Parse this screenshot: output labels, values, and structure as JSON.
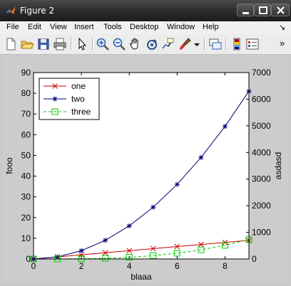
{
  "window": {
    "title": "Figure 2"
  },
  "menu": {
    "items": [
      "File",
      "Edit",
      "View",
      "Insert",
      "Tools",
      "Desktop",
      "Window",
      "Help"
    ],
    "dock_arrow": "↘"
  },
  "toolbar": {
    "icons": [
      "new-figure",
      "open-file",
      "save",
      "print",
      "edit-plot",
      "zoom-in",
      "zoom-out",
      "pan",
      "rotate-3d",
      "data-cursor",
      "brush",
      "link-plot",
      "colorbar",
      "legend"
    ],
    "overflow": "»"
  },
  "chart_data": {
    "type": "line",
    "xlabel": "blaaa",
    "ylabel_left": "fooo",
    "ylabel_right": "asdasd",
    "xlim": [
      0,
      9
    ],
    "ylim_left": [
      0,
      90
    ],
    "ylim_right": [
      0,
      7000
    ],
    "x_ticks": [
      "0",
      "2",
      "4",
      "6",
      "8"
    ],
    "y_ticks_left": [
      "0",
      "10",
      "20",
      "30",
      "40",
      "50",
      "60",
      "70",
      "80",
      "90"
    ],
    "y_ticks_right": [
      "0",
      "1000",
      "2000",
      "3000",
      "4000",
      "5000",
      "6000",
      "7000"
    ],
    "x": [
      0,
      1,
      2,
      3,
      4,
      5,
      6,
      7,
      8,
      9
    ],
    "series": [
      {
        "name": "one",
        "axis": "left",
        "color": "#cc0000",
        "marker": "x",
        "linestyle": "solid",
        "values": [
          0,
          1,
          2,
          3,
          4,
          5,
          6,
          7,
          8,
          9
        ]
      },
      {
        "name": "two",
        "axis": "left",
        "color": "#00007a",
        "marker": "*",
        "linestyle": "solid",
        "values": [
          0,
          1,
          4,
          9,
          16,
          25,
          36,
          49,
          64,
          81
        ]
      },
      {
        "name": "three",
        "axis": "right",
        "color": "#00cc00",
        "marker": "square",
        "linestyle": "dashed",
        "values": [
          0,
          1,
          8,
          27,
          64,
          125,
          216,
          343,
          512,
          729
        ]
      }
    ],
    "legend": {
      "placement": "top-left",
      "entries": [
        "one",
        "two",
        "three"
      ]
    }
  }
}
